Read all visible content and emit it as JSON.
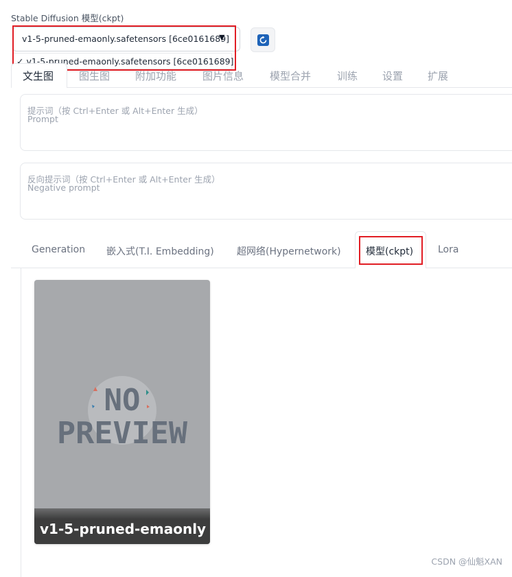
{
  "model_selector": {
    "label": "Stable Diffusion 模型(ckpt)",
    "selected_value": "v1-5-pruned-emaonly.safetensors [6ce0161689]",
    "dropdown_options": [
      {
        "label": "✓ v1-5-pruned-emaonly.safetensors [6ce0161689]",
        "selected": true
      }
    ]
  },
  "top_tabs": [
    {
      "label": "文生图",
      "active": true
    },
    {
      "label": "图生图"
    },
    {
      "label": "附加功能"
    },
    {
      "label": "图片信息"
    },
    {
      "label": "模型合并"
    },
    {
      "label": "训练"
    },
    {
      "label": "设置"
    },
    {
      "label": "扩展"
    }
  ],
  "prompt": {
    "placeholder_line1": "提示词（按 Ctrl+Enter 或 Alt+Enter 生成）",
    "placeholder_line2": "Prompt"
  },
  "negative_prompt": {
    "placeholder_line1": "反向提示词（按 Ctrl+Enter 或 Alt+Enter 生成）",
    "placeholder_line2": "Negative prompt"
  },
  "sub_tabs": [
    {
      "label": "Generation"
    },
    {
      "label": "嵌入式(T.I. Embedding)"
    },
    {
      "label": "超网络(Hypernetwork)"
    },
    {
      "label": "模型(ckpt)",
      "active": true
    },
    {
      "label": "Lora"
    }
  ],
  "model_cards": [
    {
      "name": "v1-5-pruned-emaonly",
      "preview_text_line1": "NO",
      "preview_text_line2": "PREVIEW"
    }
  ],
  "watermark": "CSDN @仙魁XAN",
  "colors": {
    "highlight": "#e11d24",
    "refresh_icon": "#1e63b8",
    "card_bg": "#a7a9ac"
  }
}
